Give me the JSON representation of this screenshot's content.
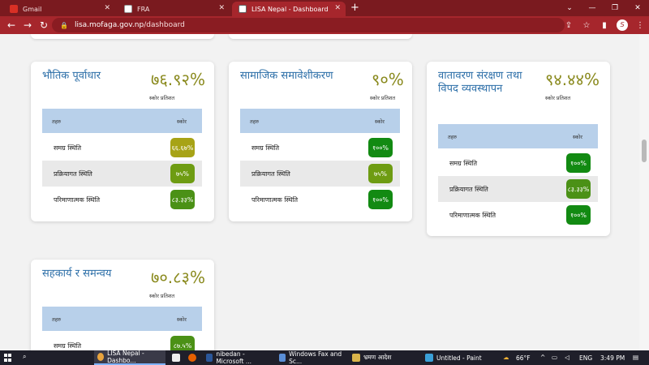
{
  "browser": {
    "tabs": [
      {
        "label": "Gmail",
        "icon": "gmail-icon",
        "color": "#d93025"
      },
      {
        "label": "FRA",
        "icon": "fra-icon",
        "color": "#ffffff"
      },
      {
        "label": "LISA Nepal - Dashboard",
        "icon": "lisa-icon",
        "color": "#ffffff"
      }
    ],
    "url_host": "lisa.mofaga.gov.np",
    "url_path": "/dashboard"
  },
  "labels": {
    "score_caption": "स्कोर प्रतिशत",
    "col_indicator": "तहरु",
    "col_score": "स्कोर"
  },
  "cards": [
    {
      "title": "भौतिक पूर्वाधार",
      "score": "७६.९२%",
      "rows": [
        {
          "label": "समग्र स्थिति",
          "value": "६६.६७%",
          "color": "#a7a316"
        },
        {
          "label": "प्रक्रियागत स्थिति",
          "value": "७५%",
          "color": "#6e9c12"
        },
        {
          "label": "परिमाणात्मक स्थिति",
          "value": "८३.३३%",
          "color": "#4b9116"
        }
      ]
    },
    {
      "title": "सामाजिक समावेशीकरण",
      "score": "९०%",
      "rows": [
        {
          "label": "समग्र स्थिति",
          "value": "१००%",
          "color": "#128a12"
        },
        {
          "label": "प्रक्रियागत स्थिति",
          "value": "७५%",
          "color": "#6e9c12"
        },
        {
          "label": "परिमाणात्मक स्थिति",
          "value": "१००%",
          "color": "#128a12"
        }
      ]
    },
    {
      "title": "वातावरण संरक्षण तथा विपद व्यवस्थापन",
      "score": "९४.४४%",
      "rows": [
        {
          "label": "समग्र स्थिति",
          "value": "१००%",
          "color": "#128a12"
        },
        {
          "label": "प्रक्रियागत स्थिति",
          "value": "८३.३३%",
          "color": "#4b9116"
        },
        {
          "label": "परिमाणात्मक स्थिति",
          "value": "१००%",
          "color": "#128a12"
        }
      ]
    },
    {
      "title": "सहकार्य र समन्वय",
      "score": "७०.८३%",
      "rows": [
        {
          "label": "समग्र स्थिति",
          "value": "८७.५%",
          "color": "#4b9116"
        }
      ]
    }
  ],
  "taskbar": {
    "items": [
      {
        "label": "LISA Nepal - Dashbo...",
        "color": "#e8a33d"
      },
      {
        "label": "nibedan - Microsoft ...",
        "color": "#2b579a"
      },
      {
        "label": "Windows Fax and Sc...",
        "color": "#5a8ed6"
      },
      {
        "label": "भ्रमण आदेश",
        "color": "#d9b44a"
      },
      {
        "label": "Untitled - Paint",
        "color": "#3aa0d8"
      }
    ],
    "weather": "66°F",
    "lang": "ENG",
    "time": "3:49 PM"
  }
}
